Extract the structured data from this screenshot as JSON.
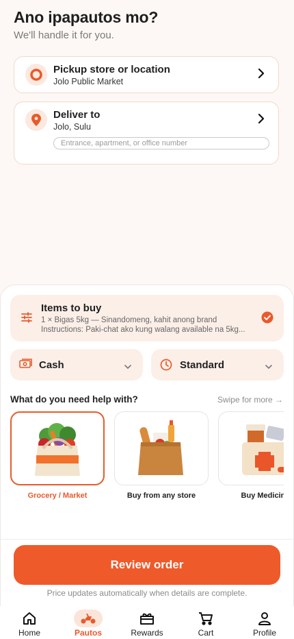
{
  "header": {
    "title": "Ano ipapautos mo?",
    "subtitle": "We'll handle it for you."
  },
  "pickup": {
    "label": "Pickup store or location",
    "value": "Jolo Public Market",
    "icon": "pickup-ring-icon"
  },
  "deliver": {
    "label": "Deliver to",
    "value": "Jolo, Sulu",
    "placeholder": "Entrance, apartment, or office number",
    "icon": "location-pin-icon"
  },
  "items": {
    "title": "Items to buy",
    "line1": "1 × Bigas 5kg — Sinandomeng, kahit anong brand",
    "line2": "Instructions: Paki-chat ako kung walang available na 5kg..."
  },
  "payment": {
    "label": "Cash",
    "icon": "cash-icon"
  },
  "speed": {
    "label": "Standard",
    "icon": "clock-icon"
  },
  "help": {
    "title": "What do you need help with?",
    "swipe": "Swipe for more →",
    "categories": [
      {
        "label": "Grocery / Market",
        "selected": true,
        "icon": "grocery-bag-icon"
      },
      {
        "label": "Buy from any store",
        "selected": false,
        "icon": "shopping-bag-icon"
      },
      {
        "label": "Buy Medicine",
        "selected": false,
        "icon": "medicine-kit-icon"
      }
    ]
  },
  "review": {
    "button": "Review order",
    "note": "Price updates automatically when details are complete."
  },
  "nav": [
    {
      "label": "Home",
      "icon": "home-icon",
      "active": false
    },
    {
      "label": "Pautos",
      "icon": "scooter-icon",
      "active": true
    },
    {
      "label": "Rewards",
      "icon": "gift-icon",
      "active": false
    },
    {
      "label": "Cart",
      "icon": "cart-icon",
      "active": false
    },
    {
      "label": "Profile",
      "icon": "profile-icon",
      "active": false
    }
  ],
  "colors": {
    "accent": "#ee5a2a",
    "card_tint": "#fcefe8",
    "background": "#fdf8f5"
  }
}
